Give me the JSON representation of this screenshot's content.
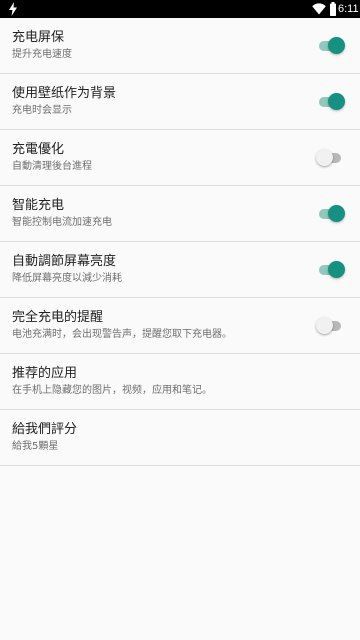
{
  "status_bar": {
    "time": "6:11",
    "icons": [
      "charging-bolt-icon",
      "wifi-icon",
      "battery-icon"
    ]
  },
  "colors": {
    "accent": "#149180",
    "toggle_on_track": "#8fc8bd",
    "toggle_off_thumb": "#f1f1f1"
  },
  "settings": [
    {
      "title": "充电屏保",
      "summary": "提升充电速度",
      "has_toggle": true,
      "checked": true
    },
    {
      "title": "使用壁纸作为背景",
      "summary": "充电时会显示",
      "has_toggle": true,
      "checked": true
    },
    {
      "title": "充電優化",
      "summary": "自動清理後台進程",
      "has_toggle": true,
      "checked": false
    },
    {
      "title": "智能充电",
      "summary": "智能控制电流加速充电",
      "has_toggle": true,
      "checked": true
    },
    {
      "title": "自動調節屏幕亮度",
      "summary": "降低屏幕亮度以減少消耗",
      "has_toggle": true,
      "checked": true
    },
    {
      "title": "完全充电的提醒",
      "summary": "电池充满时，会出现警告声，提醒您取下充电器。",
      "has_toggle": true,
      "checked": false
    },
    {
      "title": "推荐的应用",
      "summary": "在手机上隐藏您的图片，视频，应用和笔记。",
      "has_toggle": false,
      "checked": false
    },
    {
      "title": "給我們評分",
      "summary": "給我5顆星",
      "has_toggle": false,
      "checked": false
    }
  ]
}
